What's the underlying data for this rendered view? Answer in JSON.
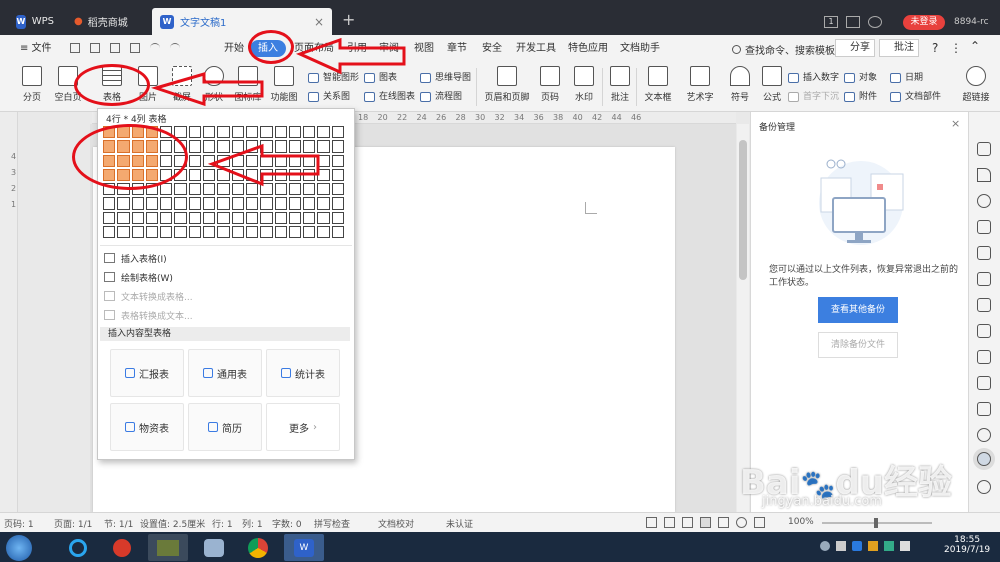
{
  "tabs": [
    {
      "label": "WPS"
    },
    {
      "label": "稻壳商城"
    },
    {
      "label": "文字文稿1"
    }
  ],
  "titlebar": {
    "new_tab": "+",
    "page_count": "1",
    "login": "未登录",
    "user_code": "8894-rc"
  },
  "menu": {
    "file": "≡ 文件",
    "items": [
      "开始",
      "插入",
      "页面布局",
      "引用",
      "审阅",
      "视图",
      "章节",
      "安全",
      "开发工具",
      "特色应用",
      "文档助手"
    ],
    "active": "插入",
    "search": "查找命令、搜索模板",
    "share": "分享",
    "comment": "批注"
  },
  "ribbon": {
    "big": [
      "分页",
      "空白页",
      "表格",
      "图片",
      "截屏",
      "形状",
      "图标库",
      "功能图"
    ],
    "small_col1": [
      "智能图形",
      "关系图"
    ],
    "small_col2": [
      "图表",
      "在线图表"
    ],
    "small_col3": [
      "思维导图",
      "流程图"
    ],
    "big2": [
      "页眉和页脚",
      "页码",
      "水印",
      "批注",
      "文本框",
      "艺术字",
      "符号",
      "公式"
    ],
    "small_col4": [
      "插入数字",
      "首字下沉"
    ],
    "small_col5": [
      "对象",
      "附件"
    ],
    "small_col6": [
      "日期",
      "文档部件"
    ],
    "last": "超链接"
  },
  "ruler_numbers": [
    "18",
    "20",
    "22",
    "24",
    "26",
    "28",
    "30",
    "32",
    "34",
    "36",
    "38",
    "40",
    "42",
    "44",
    "46"
  ],
  "left_ruler_numbers": [
    "4",
    "3",
    "2",
    "1"
  ],
  "dropdown": {
    "header": "4行 * 4列 表格",
    "rows": 8,
    "cols": 17,
    "selected_rows": 4,
    "selected_cols": 4,
    "items": [
      {
        "label": "插入表格(I)",
        "enabled": true
      },
      {
        "label": "绘制表格(W)",
        "enabled": true
      },
      {
        "label": "文本转换成表格...",
        "enabled": false
      },
      {
        "label": "表格转换成文本...",
        "enabled": false
      }
    ],
    "section": "插入内容型表格",
    "cards": [
      "汇报表",
      "通用表",
      "统计表",
      "物资表",
      "简历",
      "更多"
    ]
  },
  "panel": {
    "title": "备份管理",
    "message": "您可以通过以上文件列表，恢复异常退出之前的工作状态。",
    "view_backup": "查看其他备份",
    "clear_backup": "清除备份文件"
  },
  "status": {
    "page": "页码: 1",
    "pages": "页面: 1/1",
    "section": "节: 1/1",
    "setting": "设置值: 2.5厘米",
    "row": "行: 1",
    "col": "列: 1",
    "chars": "字数: 0",
    "spell": "拼写检查",
    "proof": "文档校对",
    "cert": "未认证",
    "zoom": "100%"
  },
  "clock": {
    "time": "18:55",
    "date": "2019/7/19"
  },
  "watermark": {
    "brand": "Bai",
    "brand2": "du",
    "cn": "经验",
    "url": "jingyan.baidu.com"
  },
  "colors": {
    "accent": "#3c7fe0",
    "selected_cell": "#f4a970",
    "annotation": "#e4101a",
    "login": "#e8413d"
  }
}
